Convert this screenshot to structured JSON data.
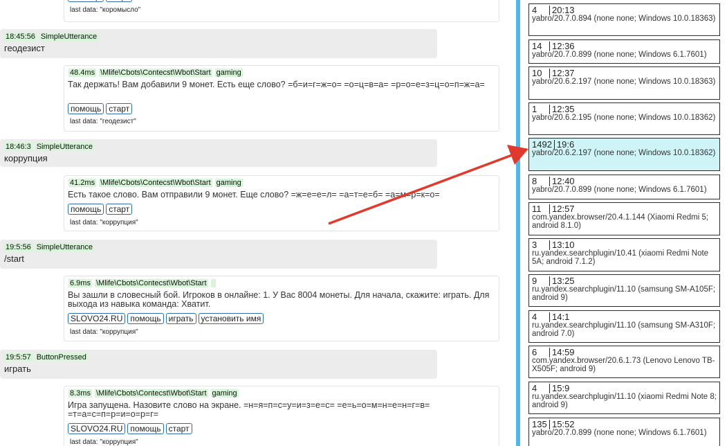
{
  "log": [
    {
      "kind": "resp-tail",
      "buttons": [
        "помощь",
        "старт"
      ],
      "last_data": "last data: \"коромысло\""
    },
    {
      "kind": "utt",
      "time": "18:45:56",
      "type": "SimpleUtterance",
      "text": "геодезист"
    },
    {
      "kind": "resp",
      "duration": "48.4ms",
      "path": "\\Mlife\\Cbots\\Contecst\\Wbot\\Start",
      "tag": "gaming",
      "text": "Так держать! Вам добавили 9 монет. Есть еще слово? =б=и=г=ж=о= =о=ц=в=а= =р=о=е=з=ц=о=п=ж=а=",
      "buttons": [
        "помощь",
        "старт"
      ],
      "last_data": "last data: \"геодезист\""
    },
    {
      "kind": "utt",
      "time": "18:46:3",
      "type": "SimpleUtterance",
      "text": "коррупция"
    },
    {
      "kind": "resp",
      "duration": "41.2ms",
      "path": "\\Mlife\\Cbots\\Contecst\\Wbot\\Start",
      "tag": "gaming",
      "text": "Есть такое слово. Вам отправили 9 монет. Еще слово? =ж=е=е=л= =а=т=е=б= =а=м=р=к=о=",
      "buttons": [
        "помощь",
        "старт"
      ],
      "last_data": "last data: \"коррупция\""
    },
    {
      "kind": "utt",
      "time": "19:5:56",
      "type": "SimpleUtterance",
      "text": "/start"
    },
    {
      "kind": "resp",
      "duration": "6.9ms",
      "path": "\\Mlife\\Cbots\\Contecst\\Wbot\\Start",
      "tag": "",
      "text": "Вы зашли в словесный бой. Игроков в онлайне: 1. У Вас 8004 монеты. Для начала, скажите: играть. Для выхода из навыка команда: Хватит.",
      "buttons": [
        "SLOVO24.RU",
        "помощь",
        "играть",
        "установить имя"
      ],
      "last_data": "last data: \"коррупция\""
    },
    {
      "kind": "utt",
      "time": "19:5:57",
      "type": "ButtonPressed",
      "text": "играть"
    },
    {
      "kind": "resp",
      "duration": "8.3ms",
      "path": "\\Mlife\\Cbots\\Contecst\\Wbot\\Start",
      "tag": "gaming",
      "text": "Игра запущена. Назовите слово на экране. =н=я=п=с=у=и=з=е=с= =е=ь=о=м=н=е=н=г=в= =т=а=с=п=р=и=о=р=г=",
      "buttons": [
        "SLOVO24.RU",
        "помощь",
        "старт"
      ],
      "last_data": "last data: \"коррупция\""
    }
  ],
  "sessions": [
    {
      "num": "4",
      "time": "20:13",
      "ua": "yabro/20.7.0.894 (none none; Windows 10.0.18363)"
    },
    {
      "num": "14",
      "time": "12:36",
      "ua": "yabro/20.7.0.899 (none none; Windows 6.1.7601)"
    },
    {
      "num": "10",
      "time": "12:37",
      "ua": "yabro/20.6.2.197 (none none; Windows 10.0.18363)"
    },
    {
      "num": "1",
      "time": "12:35",
      "ua": "yabro/20.6.2.195 (none none; Windows 10.0.18362)"
    },
    {
      "num": "1492",
      "time": "19:6",
      "ua": "yabro/20.6.2.197 (none none; Windows 10.0.18362)",
      "active": true
    },
    {
      "num": "8",
      "time": "12:40",
      "ua": "yabro/20.7.0.899 (none none; Windows 6.1.7601)"
    },
    {
      "num": "11",
      "time": "12:57",
      "ua": "com.yandex.browser/20.4.1.144 (Xiaomi Redmi 5; android 8.1.0)"
    },
    {
      "num": "3",
      "time": "13:10",
      "ua": "ru.yandex.searchplugin/10.41 (xiaomi Redmi Note 5A; android 7.1.2)"
    },
    {
      "num": "9",
      "time": "13:25",
      "ua": "ru.yandex.searchplugin/11.10 (samsung SM-A105F; android 9)"
    },
    {
      "num": "4",
      "time": "14:1",
      "ua": "ru.yandex.searchplugin/11.10 (samsung SM-A310F; android 7.0)"
    },
    {
      "num": "6",
      "time": "14:59",
      "ua": "com.yandex.browser/20.6.1.73 (Lenovo Lenovo TB-X505F; android 9)"
    },
    {
      "num": "4",
      "time": "15:9",
      "ua": "ru.yandex.searchplugin/11.10 (xiaomi Redmi Note 8; android 9)"
    },
    {
      "num": "135",
      "time": "15:52",
      "ua": "yabro/20.7.0.899 (none none; Windows 6.1.7601)"
    }
  ],
  "colors": {
    "accent": "#4fb8e6",
    "arrow": "#e03a2f",
    "active": "#cff4f8",
    "tag": "#d9f5d9"
  }
}
